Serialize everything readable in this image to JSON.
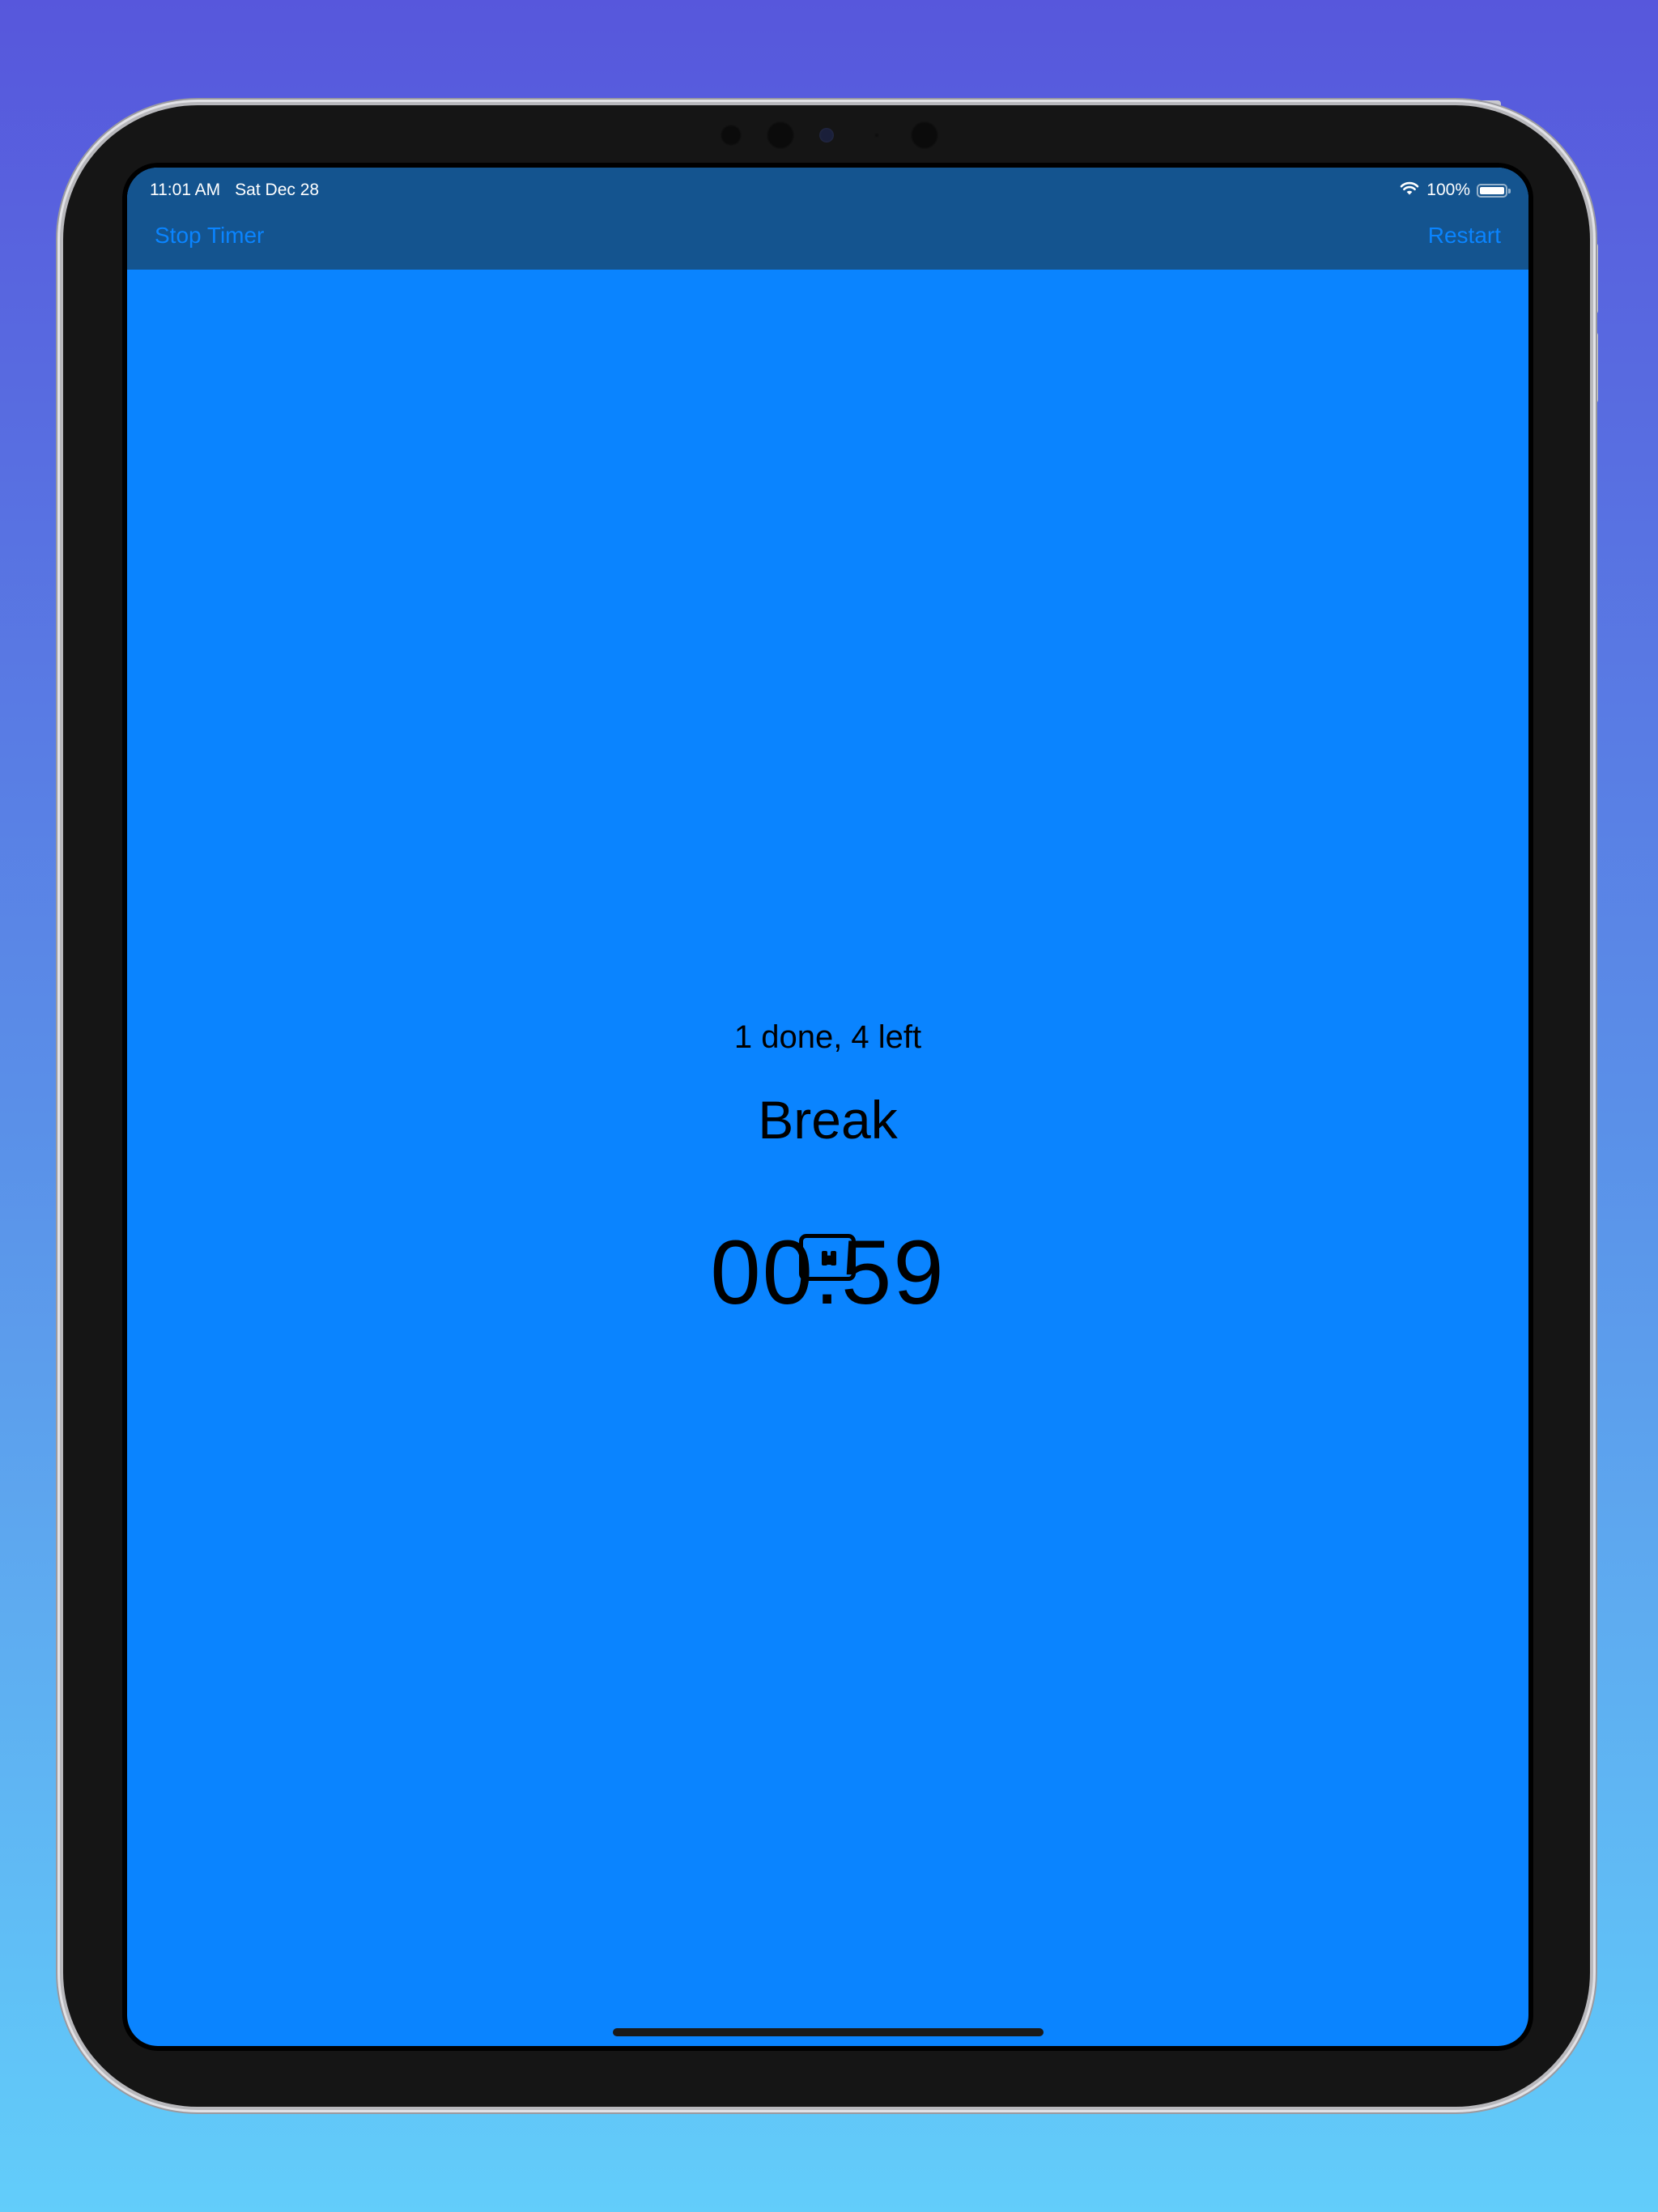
{
  "status_bar": {
    "time": "11:01 AM",
    "date": "Sat Dec 28",
    "battery_percent": "100%",
    "wifi_icon": "wifi-icon",
    "battery_icon": "battery-icon",
    "battery_level": 1.0
  },
  "nav": {
    "stop_label": "Stop Timer",
    "restart_label": "Restart"
  },
  "main": {
    "progress_text": "1 done, 4 left",
    "phase_label": "Break",
    "timer_value": "00:59",
    "pause_icon": "pause-icon"
  },
  "colors": {
    "accent": "#0a84ff",
    "nav_bar": "#14548f",
    "background": "#0a84ff",
    "text": "#000000"
  }
}
